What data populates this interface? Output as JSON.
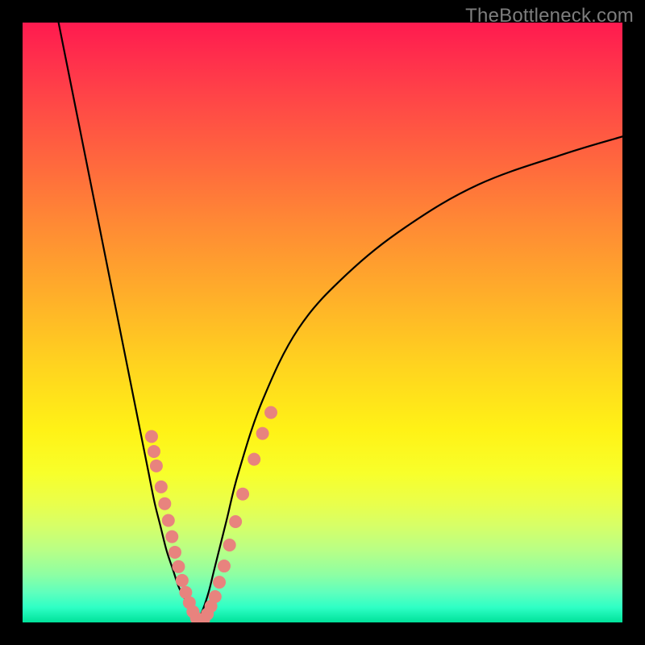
{
  "watermark": "TheBottleneck.com",
  "chart_data": {
    "type": "line",
    "title": "",
    "xlabel": "",
    "ylabel": "",
    "xlim": [
      0,
      100
    ],
    "ylim": [
      0,
      100
    ],
    "grid": false,
    "legend": false,
    "background": "rainbow-vertical-gradient",
    "series": [
      {
        "name": "left-curve",
        "x": [
          6,
          8,
          10,
          12,
          14,
          16,
          18,
          20,
          21,
          22,
          23,
          24,
          25,
          26,
          27,
          28,
          29
        ],
        "y": [
          100,
          90,
          80,
          70,
          60,
          50,
          40,
          30,
          25,
          20,
          16,
          12,
          9,
          6,
          4,
          2,
          0
        ]
      },
      {
        "name": "right-curve",
        "x": [
          29,
          30,
          31,
          32,
          34,
          36,
          40,
          46,
          54,
          64,
          76,
          90,
          100
        ],
        "y": [
          0,
          2,
          5,
          9,
          17,
          25,
          37,
          49,
          58,
          66,
          73,
          78,
          81
        ]
      }
    ],
    "scatter_points": {
      "name": "highlighted-dots",
      "points": [
        {
          "x": 21.5,
          "y": 31.0
        },
        {
          "x": 21.9,
          "y": 28.5
        },
        {
          "x": 22.3,
          "y": 26.1
        },
        {
          "x": 23.1,
          "y": 22.6
        },
        {
          "x": 23.7,
          "y": 19.8
        },
        {
          "x": 24.3,
          "y": 17.0
        },
        {
          "x": 24.9,
          "y": 14.3
        },
        {
          "x": 25.4,
          "y": 11.7
        },
        {
          "x": 26.0,
          "y": 9.3
        },
        {
          "x": 26.6,
          "y": 7.0
        },
        {
          "x": 27.2,
          "y": 5.0
        },
        {
          "x": 27.8,
          "y": 3.3
        },
        {
          "x": 28.4,
          "y": 1.8
        },
        {
          "x": 29.0,
          "y": 0.7
        },
        {
          "x": 29.6,
          "y": 0.2
        },
        {
          "x": 30.2,
          "y": 0.5
        },
        {
          "x": 30.8,
          "y": 1.4
        },
        {
          "x": 31.4,
          "y": 2.7
        },
        {
          "x": 32.1,
          "y": 4.3
        },
        {
          "x": 32.8,
          "y": 6.7
        },
        {
          "x": 33.6,
          "y": 9.4
        },
        {
          "x": 34.5,
          "y": 12.9
        },
        {
          "x": 35.5,
          "y": 16.8
        },
        {
          "x": 36.7,
          "y": 21.4
        },
        {
          "x": 38.6,
          "y": 27.2
        },
        {
          "x": 40.0,
          "y": 31.5
        },
        {
          "x": 41.4,
          "y": 35.0
        }
      ]
    }
  }
}
